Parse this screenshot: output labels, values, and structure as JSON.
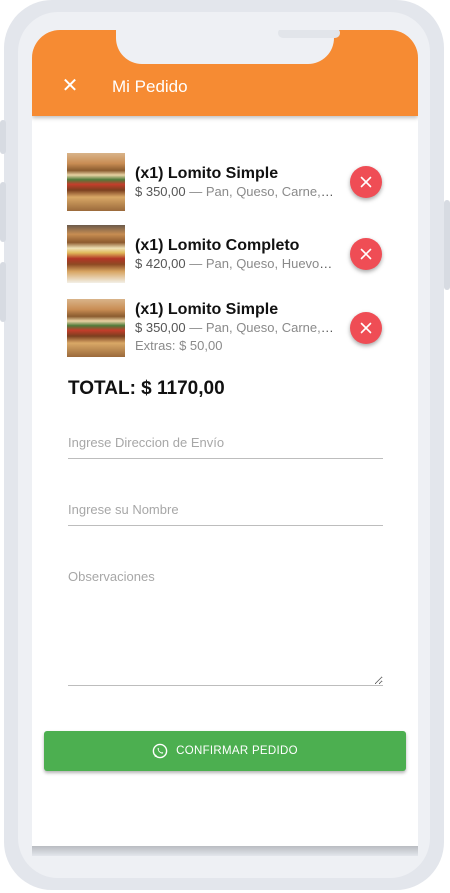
{
  "header": {
    "title": "Mi Pedido",
    "close_glyph": "✕",
    "background": "#f68b33"
  },
  "order": {
    "items": [
      {
        "title": "(x1) Lomito Simple",
        "price": "$ 350,00",
        "ingredients": " — Pan, Queso, Carne, A...",
        "extras": "",
        "image": "lomito-simple-photo"
      },
      {
        "title": "(x1) Lomito Completo",
        "price": "$ 420,00",
        "ingredients": " — Pan, Queso, Huevo, J...",
        "extras": "",
        "image": "lomito-completo-photo"
      },
      {
        "title": "(x1) Lomito Simple",
        "price": "$ 350,00",
        "ingredients": " — Pan, Queso, Carne, A...",
        "extras": "Extras: $ 50,00",
        "image": "lomito-simple-photo"
      }
    ],
    "remove_color": "#ef4d55",
    "total": "TOTAL: $ 1170,00"
  },
  "form": {
    "address_placeholder": "Ingrese Direccion de Envío",
    "name_placeholder": "Ingrese su Nombre",
    "notes_placeholder": "Observaciones"
  },
  "confirm": {
    "label": "CONFIRMAR PEDIDO",
    "icon": "whatsapp-icon",
    "color": "#4caf50"
  }
}
